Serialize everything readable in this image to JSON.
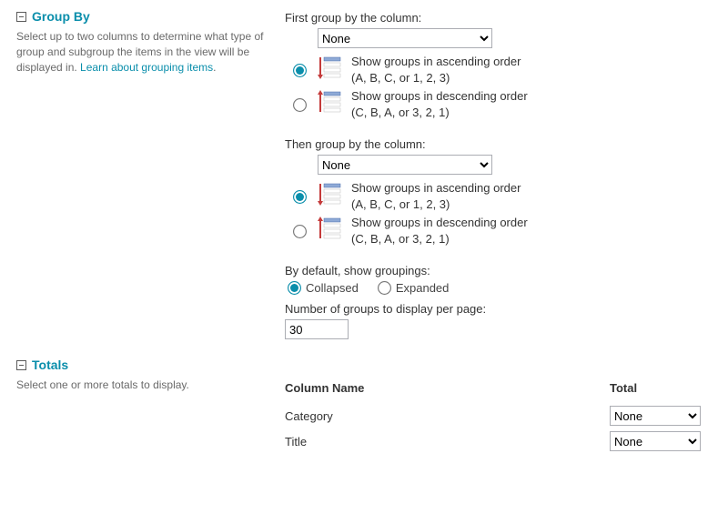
{
  "groupBy": {
    "title": "Group By",
    "help": "Select up to two columns to determine what type of group and subgroup the items in the view will be displayed in. ",
    "helpLinkText": "Learn about grouping items",
    "firstLabel": "First group by the column:",
    "thenLabel": "Then group by the column:",
    "columnOptions": [
      "None"
    ],
    "firstSelected": "None",
    "thenSelected": "None",
    "ascending": {
      "line1": "Show groups in ascending order",
      "line2": "(A, B, C, or 1, 2, 3)"
    },
    "descending": {
      "line1": "Show groups in descending order",
      "line2": "(C, B, A, or 3, 2, 1)"
    },
    "defaultLabel": "By default, show groupings:",
    "collapsedLabel": "Collapsed",
    "expandedLabel": "Expanded",
    "defaultSelected": "collapsed",
    "perPageLabel": "Number of groups to display per page:",
    "perPageValue": "30"
  },
  "totals": {
    "title": "Totals",
    "help": "Select one or more totals to display.",
    "columnHeader": "Column Name",
    "totalHeader": "Total",
    "rows": [
      {
        "name": "Category",
        "selected": "None"
      },
      {
        "name": "Title",
        "selected": "None"
      }
    ],
    "totalOptions": [
      "None"
    ]
  }
}
